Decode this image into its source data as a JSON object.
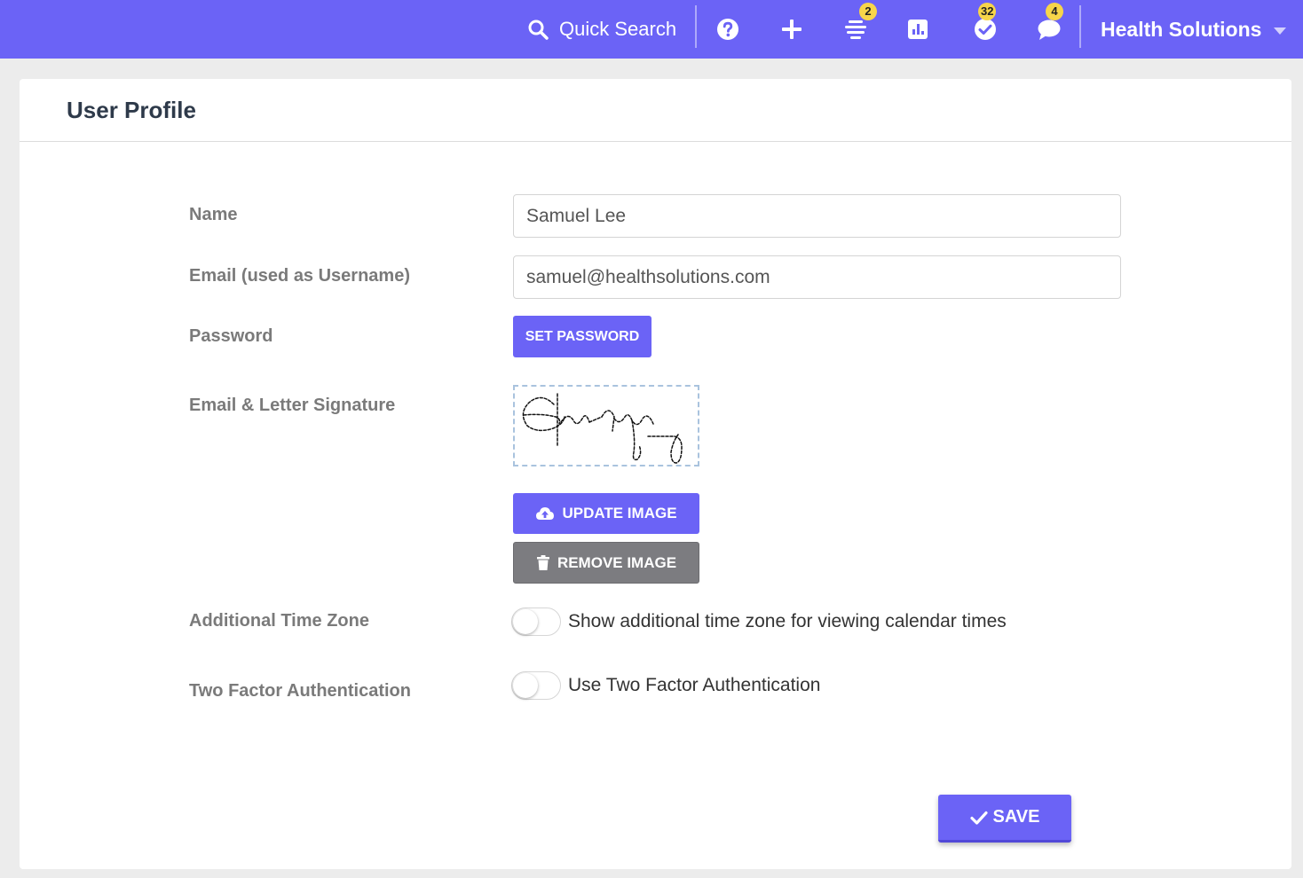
{
  "topbar": {
    "search_label": "Quick Search",
    "icons": {
      "help": "help-circle-icon",
      "add": "plus-icon",
      "feed": "list-feed-icon",
      "reports": "bar-chart-icon",
      "tasks": "check-circle-icon",
      "messages": "chat-bubble-icon"
    },
    "badges": {
      "feed": "2",
      "tasks": "32",
      "messages": "4"
    },
    "org_name": "Health Solutions",
    "bar_color": "#6b63f6",
    "badge_color": "#f7d54a"
  },
  "page": {
    "title": "User Profile"
  },
  "form": {
    "name_label": "Name",
    "name_value": "Samuel Lee",
    "email_label": "Email (used as Username)",
    "email_value": "samuel@healthsolutions.com",
    "password_label": "Password",
    "set_password_label": "SET PASSWORD",
    "signature_label": "Email & Letter Signature",
    "update_image_label": "UPDATE IMAGE",
    "remove_image_label": "REMOVE IMAGE",
    "timezone_label": "Additional Time Zone",
    "timezone_toggle_text": "Show additional time zone for viewing calendar times",
    "timezone_enabled": false,
    "twofa_label": "Two Factor Authentication",
    "twofa_toggle_text": "Use Two Factor Authentication",
    "twofa_enabled": false
  },
  "footer": {
    "save_label": "SAVE"
  }
}
